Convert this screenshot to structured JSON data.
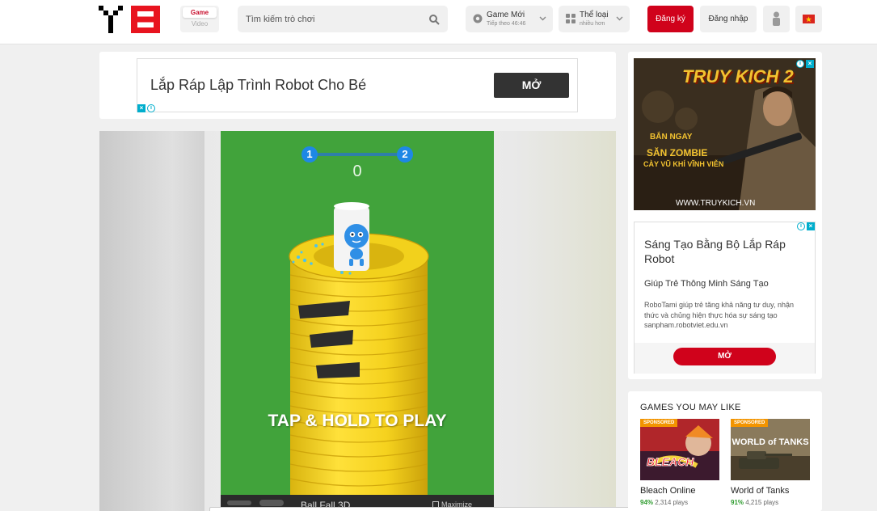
{
  "header": {
    "logo_alt": "Y8",
    "toggle": {
      "game_label": "Game",
      "video_label": "Video"
    },
    "search": {
      "placeholder": "Tìm kiếm trò chơi"
    },
    "new_games": {
      "title": "Game Mới",
      "subtitle": "Tiếp theo 46:46"
    },
    "categories": {
      "title": "Thể loại",
      "subtitle": "nhiều hơn"
    },
    "register_label": "Đăng ký",
    "login_label": "Đăng nhập",
    "icons": {
      "search": "search-icon",
      "new_games": "gear-icon",
      "categories": "grid-icon",
      "user": "user-icon",
      "language": "vietnam-flag-icon"
    },
    "colors": {
      "brand": "#d0021b",
      "logo_red": "#e8141f"
    }
  },
  "top_ad": {
    "title": "Lắp Ráp Lập Trình Robot Cho Bé",
    "button": "MỞ"
  },
  "game": {
    "level_current": "1",
    "level_next": "2",
    "score": "0",
    "prompt": "TAP & HOLD TO PLAY",
    "title": "Ball Fall 3D",
    "maximize_label": "Maximize",
    "colors": {
      "background": "#41a33b",
      "tower": "#f2d11c",
      "player": "#2f8fe6"
    }
  },
  "right_ads": {
    "game_ad": {
      "logo": "TRUY KICH 2",
      "play": "BẮN NGAY",
      "headline": "SĂN ZOMBIE",
      "tagline": "CÀY VŨ KHÍ VĨNH VIỄN",
      "url": "WWW.TRUYKICH.VN"
    },
    "text_ad": {
      "title": "Sáng Tạo Bằng Bộ Lắp Ráp Robot",
      "subtitle": "Giúp Trẻ Thông Minh Sáng Tạo",
      "description": "RoboTami giúp trẻ tăng khả năng tư duy, nhận thức và chủng hiện thực hóa sự sáng tạo",
      "domain": "sanpham.robotviet.edu.vn",
      "button": "MỞ"
    }
  },
  "games_you_may_like": {
    "title": "GAMES YOU MAY LIKE",
    "items": [
      {
        "badge": "SPONSORED",
        "name": "Bleach Online",
        "rating": "94%",
        "plays": "2,314 plays"
      },
      {
        "badge": "SPONSORED",
        "name": "World of Tanks",
        "rating": "91%",
        "plays": "4,215 plays"
      }
    ]
  }
}
